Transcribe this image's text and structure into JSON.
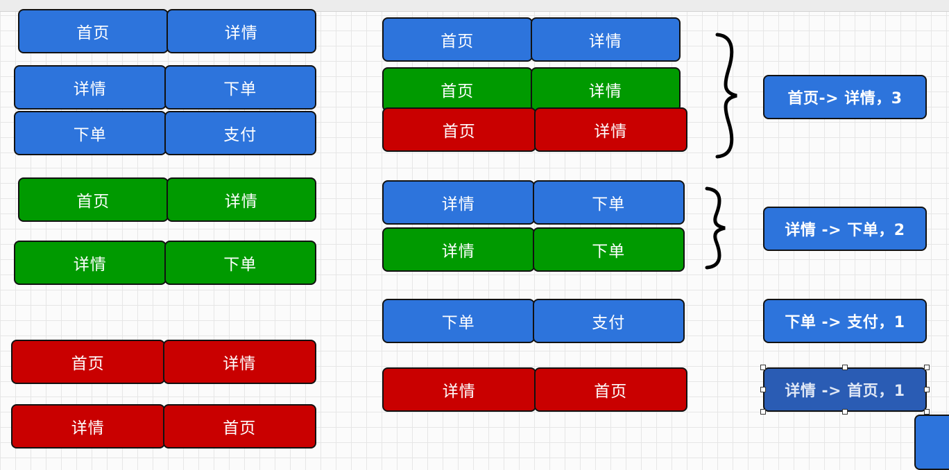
{
  "left_column": {
    "blue": [
      [
        "首页",
        "详情"
      ],
      [
        "详情",
        "下单"
      ],
      [
        "下单",
        "支付"
      ]
    ],
    "green": [
      [
        "首页",
        "详情"
      ],
      [
        "详情",
        "下单"
      ]
    ],
    "red": [
      [
        "首页",
        "详情"
      ],
      [
        "详情",
        "首页"
      ]
    ]
  },
  "middle_column": {
    "group1": [
      [
        "首页",
        "详情"
      ],
      [
        "首页",
        "详情"
      ],
      [
        "首页",
        "详情"
      ]
    ],
    "group2": [
      [
        "详情",
        "下单"
      ],
      [
        "详情",
        "下单"
      ]
    ],
    "group3": [
      [
        "下单",
        "支付"
      ]
    ],
    "group4": [
      [
        "详情",
        "首页"
      ]
    ]
  },
  "summaries": [
    "首页-> 详情，3",
    "详情 -> 下单，2",
    "下单 -> 支付，1",
    "详情 -> 首页，1"
  ],
  "colors": {
    "blue": "#2d74dc",
    "green": "#009a00",
    "red": "#c90000",
    "selected": "#2a5cb4"
  }
}
